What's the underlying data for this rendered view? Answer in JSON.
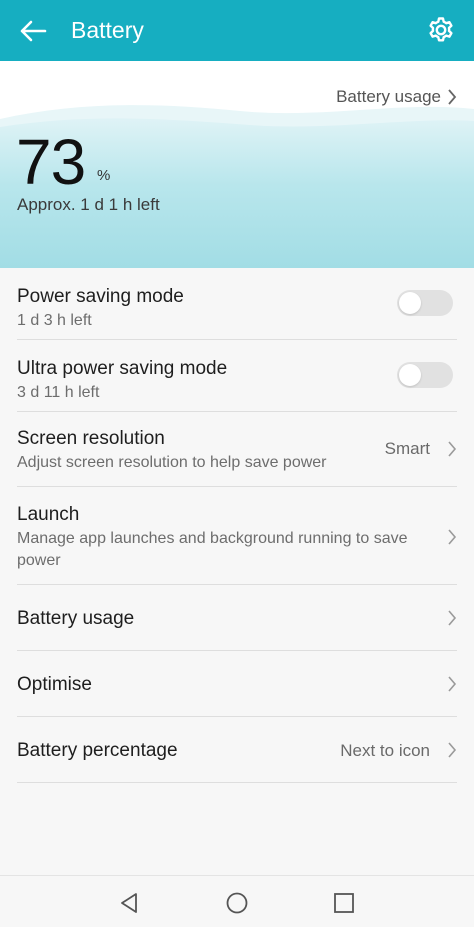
{
  "header": {
    "title": "Battery",
    "back_icon": "arrow-left-icon",
    "settings_icon": "gear-icon",
    "color": "#16aec1"
  },
  "hero": {
    "usage_link": "Battery usage",
    "percent": "73",
    "percent_sign": "%",
    "approx": "Approx. 1 d 1 h left",
    "wave_color": "#a9e1e8"
  },
  "settings": [
    {
      "title": "Power saving mode",
      "subtitle": "1 d 3 h left",
      "toggle": false
    },
    {
      "title": "Ultra power saving mode",
      "subtitle": "3 d 11 h left",
      "toggle": false
    },
    {
      "title": "Screen resolution",
      "subtitle": "Adjust screen resolution to help save power",
      "value": "Smart"
    },
    {
      "title": "Launch",
      "subtitle": "Manage app launches and background running to save power"
    },
    {
      "title": "Battery usage"
    },
    {
      "title": "Optimise"
    },
    {
      "title": "Battery percentage",
      "value": "Next to icon"
    }
  ],
  "navbar": {
    "back_icon": "triangle-back-icon",
    "home_icon": "circle-home-icon",
    "recents_icon": "square-recents-icon"
  }
}
